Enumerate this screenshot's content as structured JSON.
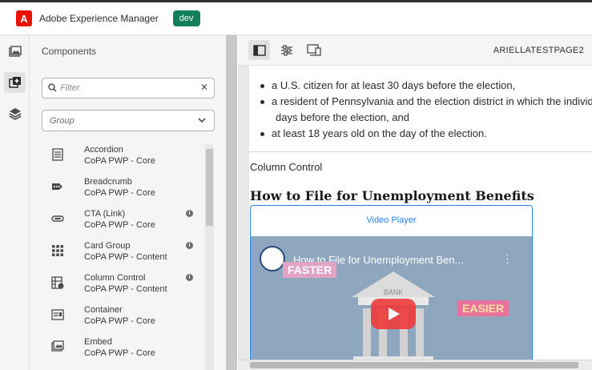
{
  "header": {
    "app_title": "Adobe Experience Manager",
    "env_badge": "dev",
    "brand_color": "#eb1000",
    "env_color": "#12805c"
  },
  "rail": {
    "items": [
      "assets-icon",
      "components-icon",
      "content-tree-icon"
    ],
    "active": "components-icon"
  },
  "panel": {
    "title": "Components",
    "filter_placeholder": "Filter",
    "group_placeholder": "Group",
    "components": [
      {
        "name": "Accordion",
        "group": "CoPA PWP - Core",
        "icon": "accordion-icon",
        "info": false
      },
      {
        "name": "Breadcrumb",
        "group": "CoPA PWP - Core",
        "icon": "breadcrumb-icon",
        "info": false
      },
      {
        "name": "CTA (Link)",
        "group": "CoPA PWP - Core",
        "icon": "cta-link-icon",
        "info": true
      },
      {
        "name": "Card Group",
        "group": "CoPA PWP - Content",
        "icon": "card-group-icon",
        "info": true
      },
      {
        "name": "Column Control",
        "group": "CoPA PWP - Content",
        "icon": "column-control-icon",
        "info": true
      },
      {
        "name": "Container",
        "group": "CoPA PWP - Core",
        "icon": "container-icon",
        "info": false
      },
      {
        "name": "Embed",
        "group": "CoPA PWP - Core",
        "icon": "embed-icon",
        "info": false
      }
    ]
  },
  "toolbar": {
    "page_name": "ARIELLATESTPAGE2",
    "buttons": [
      "toggle-side-panel-icon",
      "page-properties-icon",
      "emulator-icon"
    ]
  },
  "page": {
    "bullets": [
      "a U.S. citizen for at least 30 days before the election,",
      "a resident of Pennsylvania and the election district in which the individual",
      "days before the election, and",
      "at least 18 years old on the day of the election."
    ],
    "column_control": "Column Control",
    "heading": "How to File for Unemployment Benefits",
    "video_label": "Video Player",
    "video_title": "How to File for Unemployment Ben...",
    "video_tag_left": "FASTER",
    "video_tag_right": "EASIER",
    "video_bank_text": "BANK"
  }
}
